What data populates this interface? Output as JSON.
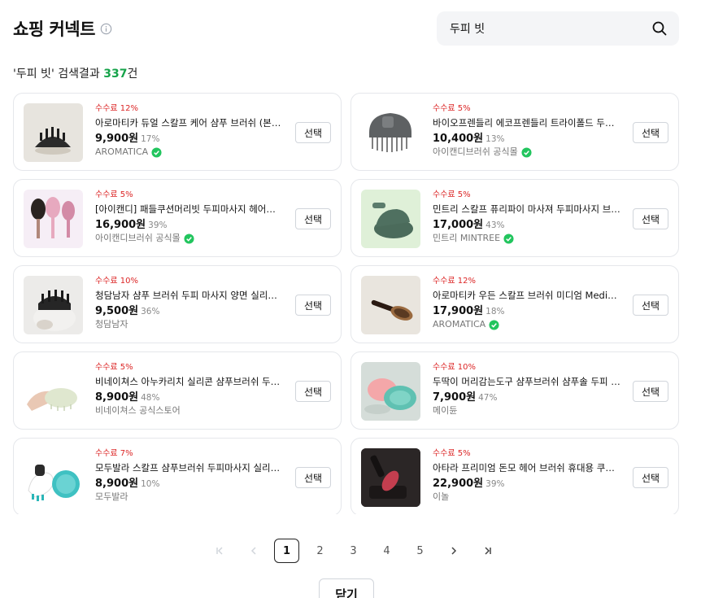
{
  "header": {
    "title": "쇼핑 커넥트",
    "info_icon": "info-icon"
  },
  "search": {
    "value": "두피 빗",
    "icon": "search-icon"
  },
  "results": {
    "prefix": "'두피 빗' 검색결과 ",
    "count": "337",
    "suffix": "건"
  },
  "products": [
    {
      "commission": "수수료 12%",
      "name": "아로마티카 듀얼 스칼프 케어 샴푸 브러쉬 (본체+교체솔)",
      "price": "9,900원",
      "discount": "17%",
      "store": "AROMATICA",
      "verified": true,
      "select_label": "선택",
      "thumb_bg": "#e7e4de"
    },
    {
      "commission": "수수료 5%",
      "name": "바이오프렌들리 에코프렌들리 트라이폴드 두피 브러쉬",
      "price": "10,400원",
      "discount": "13%",
      "store": "아이캔디브러쉬 공식몰",
      "verified": true,
      "select_label": "선택",
      "thumb_bg": "#ffffff"
    },
    {
      "commission": "수수료 5%",
      "name": "[아이캔디] 패들쿠션머리빗 두피마사지 헤어브러쉬",
      "price": "16,900원",
      "discount": "39%",
      "store": "아이캔디브러쉬 공식몰",
      "verified": true,
      "select_label": "선택",
      "thumb_bg": "#f6eef6"
    },
    {
      "commission": "수수료 5%",
      "name": "민트리 스칼프 퓨리파이 마사져 두피마사지 브러쉬",
      "price": "17,000원",
      "discount": "43%",
      "store": "민트리 MINTREE",
      "verified": true,
      "select_label": "선택",
      "thumb_bg": "#dff0d8"
    },
    {
      "commission": "수수료 10%",
      "name": "청담남자 샴푸 브러쉬 두피 마사지 양면 실리콘 브러시",
      "price": "9,500원",
      "discount": "36%",
      "store": "청담남자",
      "verified": false,
      "select_label": "선택",
      "thumb_bg": "#ecebe9"
    },
    {
      "commission": "수수료 12%",
      "name": "아로마티카 우든 스칼프 브러쉬 미디엄 Medium",
      "price": "17,900원",
      "discount": "18%",
      "store": "AROMATICA",
      "verified": true,
      "select_label": "선택",
      "thumb_bg": "#e9e5de"
    },
    {
      "commission": "수수료 5%",
      "name": "비네이쳐스 아누카리치 실리콘 샴푸브러쉬 두피마사지",
      "price": "8,900원",
      "discount": "48%",
      "store": "비네이쳐스 공식스토어",
      "verified": false,
      "select_label": "선택",
      "thumb_bg": "#ffffff"
    },
    {
      "commission": "수수료 10%",
      "name": "두딱이 머리감는도구 샴푸브러쉬 샴푸솔 두피 마사지",
      "price": "7,900원",
      "discount": "47%",
      "store": "메이듄",
      "verified": false,
      "select_label": "선택",
      "thumb_bg": "#d5ddd9"
    },
    {
      "commission": "수수료 7%",
      "name": "모두발라 스칼프 샴푸브러쉬 두피마사지 실리콘 브러쉬",
      "price": "8,900원",
      "discount": "10%",
      "store": "모두발라",
      "verified": false,
      "select_label": "선택",
      "thumb_bg": "#ffffff"
    },
    {
      "commission": "수수료 5%",
      "name": "아타라 프리미엄 돈모 헤어 브러쉬 휴대용 쿠션 빗",
      "price": "22,900원",
      "discount": "39%",
      "store": "이놀",
      "verified": false,
      "select_label": "선택",
      "thumb_bg": "#3a3535"
    }
  ],
  "pagination": {
    "first_icon": "first-page-icon",
    "prev_icon": "chevron-left-icon",
    "pages": [
      "1",
      "2",
      "3",
      "4",
      "5"
    ],
    "current": "1",
    "next_icon": "chevron-right-icon",
    "last_icon": "last-page-icon"
  },
  "footer": {
    "close_label": "닫기"
  },
  "colors": {
    "commission": "#dc2626",
    "count": "#16a34a",
    "verified": "#22c55e"
  }
}
